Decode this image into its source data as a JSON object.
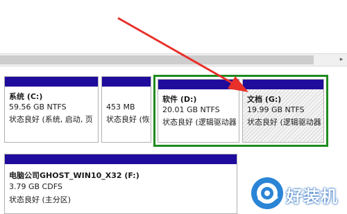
{
  "scrollbar": {
    "arrow": "▸"
  },
  "partitions": {
    "c": {
      "name": "系统 (C:)",
      "size": "59.56 GB NTFS",
      "status": "状态良好 (系统, 启动, 页"
    },
    "unnamed": {
      "size": "453 MB",
      "status": "状态良好 (恢"
    },
    "d": {
      "name": "软件 (D:)",
      "size": "20.01 GB NTFS",
      "status": "状态良好 (逻辑驱动器"
    },
    "g": {
      "name": "文档 (G:)",
      "size": "19.99 GB NTFS",
      "status": "状态良好 (逻辑驱动器"
    },
    "f": {
      "name": "电脑公司GHOST_WIN10_X32 (F:)",
      "size": "3.79 GB CDFS",
      "status": "状态良好 (主分区)"
    }
  },
  "colors": {
    "partition_bar": "#1f0c9c",
    "selection": "#1f8a1f",
    "arrow": "#e8302a"
  },
  "watermark": {
    "text": "好装机",
    "icon": "logo-icon"
  }
}
